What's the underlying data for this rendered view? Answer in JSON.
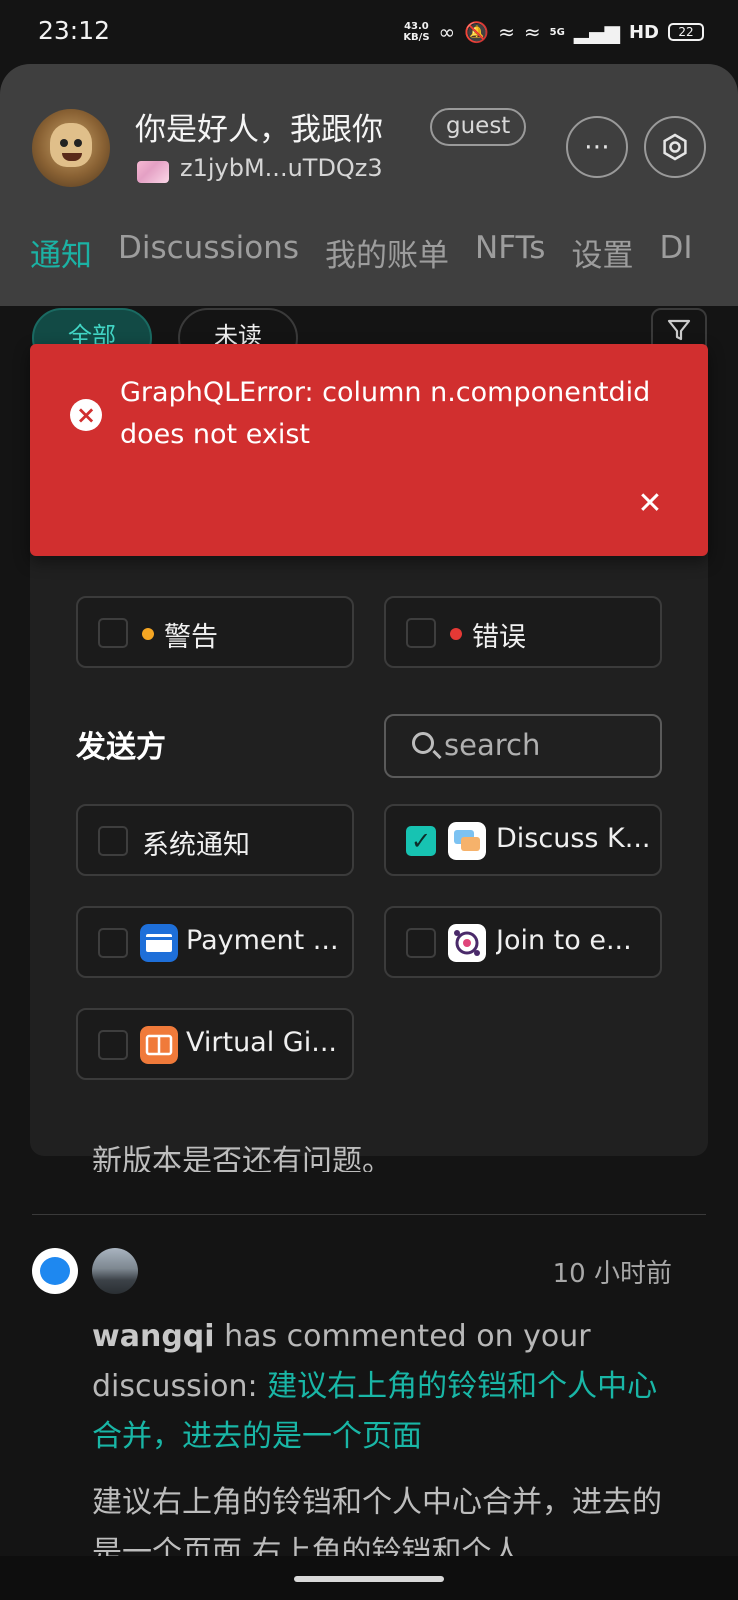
{
  "status_bar": {
    "time": "23:12",
    "net_speed_value": "43.0",
    "net_speed_unit": "KB/S",
    "network_type": "5G",
    "hd_label": "HD",
    "battery": "22"
  },
  "header": {
    "username": "你是好人，我跟你",
    "role_badge": "guest",
    "address": "z1jybM...uTDQz3",
    "more_icon": "more-horizontal-icon",
    "settings_icon": "hexagon-settings-icon"
  },
  "tabs": [
    {
      "label": "通知",
      "active": true
    },
    {
      "label": "Discussions",
      "active": false
    },
    {
      "label": "我的账单",
      "active": false
    },
    {
      "label": "NFTs",
      "active": false
    },
    {
      "label": "设置",
      "active": false
    },
    {
      "label": "DI",
      "active": false
    }
  ],
  "filter_chips": {
    "all": "全部",
    "unread": "未读"
  },
  "filter_panel": {
    "severity": [
      {
        "label": "警告",
        "color": "#f5a623",
        "checked": false
      },
      {
        "label": "错误",
        "color": "#e53935",
        "checked": false
      }
    ],
    "sender_title": "发送方",
    "search_placeholder": "search",
    "senders": [
      {
        "label": "系统通知",
        "checked": false
      },
      {
        "label": "Discuss K...",
        "checked": true
      },
      {
        "label": "Payment ...",
        "checked": false
      },
      {
        "label": "Join to e...",
        "checked": false
      },
      {
        "label": "Virtual Gi...",
        "checked": false
      }
    ]
  },
  "error_toast": {
    "message": "GraphQLError: column n.componentdid does not exist",
    "close_icon": "close-icon",
    "color": "#d12f2f"
  },
  "notifications": {
    "partial_text": "新版本是否还有问题。",
    "item": {
      "time": "10 小时前",
      "actor": "wangqi",
      "action": " has commented on your discussion: ",
      "discussion_title": "建议右上角的铃铛和个人中心合并，进去的是一个页面",
      "preview": "建议右上角的铃铛和个人中心合并，进去的是一个页面 右上角的铃铛和个人"
    }
  },
  "accent_color": "#1bb2a4"
}
